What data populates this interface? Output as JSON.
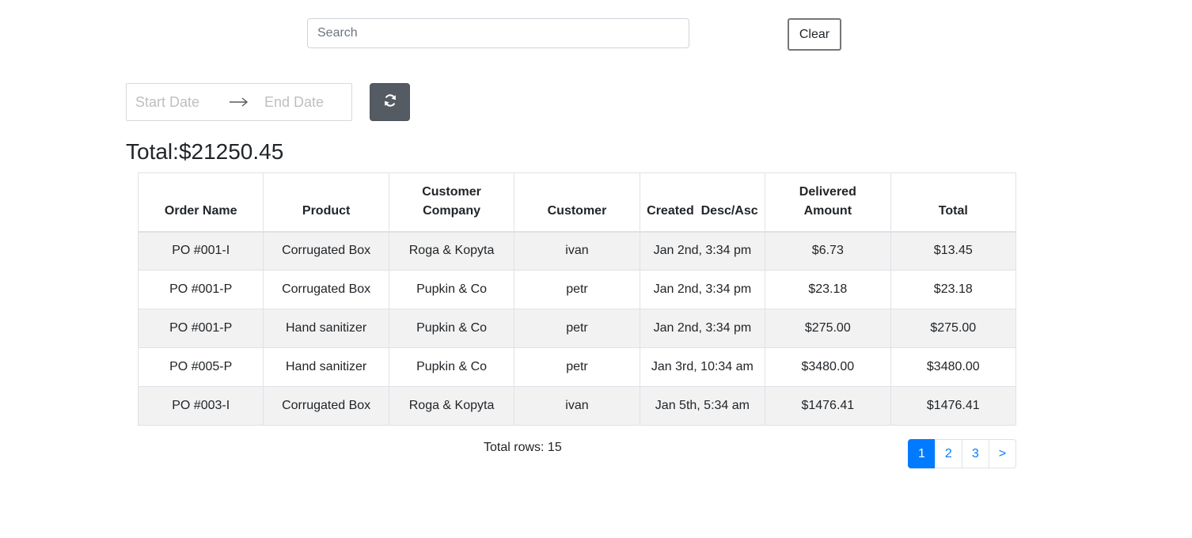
{
  "search": {
    "placeholder": "Search",
    "value": ""
  },
  "clear_button": {
    "label": "Clear"
  },
  "date_range": {
    "start_placeholder": "Start Date",
    "end_placeholder": "End Date",
    "separator_icon": "arrow-right-icon"
  },
  "refresh_button": {
    "icon": "refresh-icon"
  },
  "total": {
    "label": "Total:",
    "value": "$21250.45"
  },
  "table": {
    "columns": [
      {
        "line1": "",
        "line2": "Order Name"
      },
      {
        "line1": "",
        "line2": "Product"
      },
      {
        "line1": "Customer",
        "line2": "Company"
      },
      {
        "line1": "",
        "line2": "Customer"
      },
      {
        "line1": "",
        "line2": "Created  Desc/Asc"
      },
      {
        "line1": "Delivered",
        "line2": "Amount"
      },
      {
        "line1": "",
        "line2": "Total"
      }
    ],
    "rows": [
      [
        "PO #001-I",
        "Corrugated Box",
        "Roga & Kopyta",
        "ivan",
        "Jan 2nd, 3:34 pm",
        "$6.73",
        "$13.45"
      ],
      [
        "PO #001-P",
        "Corrugated Box",
        "Pupkin & Co",
        "petr",
        "Jan 2nd, 3:34 pm",
        "$23.18",
        "$23.18"
      ],
      [
        "PO #001-P",
        "Hand sanitizer",
        "Pupkin & Co",
        "petr",
        "Jan 2nd, 3:34 pm",
        "$275.00",
        "$275.00"
      ],
      [
        "PO #005-P",
        "Hand sanitizer",
        "Pupkin & Co",
        "petr",
        "Jan 3rd, 10:34 am",
        "$3480.00",
        "$3480.00"
      ],
      [
        "PO #003-I",
        "Corrugated Box",
        "Roga & Kopyta",
        "ivan",
        "Jan 5th, 5:34 am",
        "$1476.41",
        "$1476.41"
      ]
    ]
  },
  "footer": {
    "total_rows": "Total rows: 15"
  },
  "pagination": {
    "pages": [
      "1",
      "2",
      "3"
    ],
    "next_label": ">",
    "active": "1"
  },
  "colors": {
    "primary": "#007bff",
    "refresh_bg": "#545b62",
    "stripe": "#f2f2f2"
  }
}
